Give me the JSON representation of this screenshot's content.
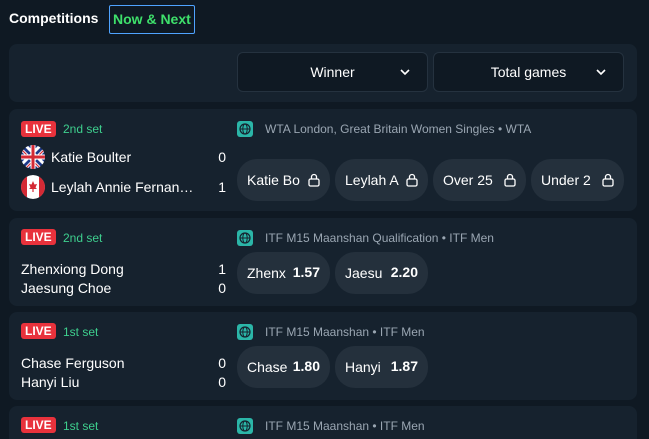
{
  "tabs": {
    "competitions": "Competitions",
    "now_next": "Now & Next"
  },
  "header": {
    "dropdowns": [
      {
        "label": "Winner",
        "icon": "chevron-down-icon"
      },
      {
        "label": "Total games",
        "icon": "chevron-down-icon"
      }
    ]
  },
  "matches": [
    {
      "status": "LIVE",
      "set": "2nd set",
      "competition": "WTA London, Great Britain Women Singles • WTA",
      "players": [
        {
          "name": "Katie Boulter",
          "score": "0",
          "flag": "uk-flag-icon"
        },
        {
          "name": "Leylah Annie Fernan…",
          "score": "1",
          "flag": "canada-flag-icon"
        }
      ],
      "odds": [
        {
          "label": "Katie Bo",
          "locked": true
        },
        {
          "label": "Leylah A",
          "locked": true
        },
        {
          "label": "Over 25",
          "locked": true
        },
        {
          "label": "Under 2",
          "locked": true
        }
      ]
    },
    {
      "status": "LIVE",
      "set": "2nd set",
      "competition": "ITF M15 Maanshan Qualification • ITF Men",
      "players": [
        {
          "name": "Zhenxiong Dong",
          "score": "1"
        },
        {
          "name": "Jaesung Choe",
          "score": "0"
        }
      ],
      "odds": [
        {
          "label": "Zhenx",
          "price": "1.57"
        },
        {
          "label": "Jaesu",
          "price": "2.20"
        }
      ]
    },
    {
      "status": "LIVE",
      "set": "1st set",
      "competition": "ITF M15 Maanshan • ITF Men",
      "players": [
        {
          "name": "Chase Ferguson",
          "score": "0"
        },
        {
          "name": "Hanyi Liu",
          "score": "0"
        }
      ],
      "odds": [
        {
          "label": "Chase",
          "price": "1.80"
        },
        {
          "label": "Hanyi",
          "price": "1.87"
        }
      ]
    },
    {
      "status": "LIVE",
      "set": "1st set",
      "competition": "ITF M15 Maanshan • ITF Men",
      "players": [],
      "odds": []
    }
  ],
  "colors": {
    "background": "#0f1923",
    "card": "#16222e",
    "live": "#e8323c",
    "set_text": "#3ecf8e",
    "active_tab": "#3ee06b",
    "odds_button": "#24303c"
  }
}
